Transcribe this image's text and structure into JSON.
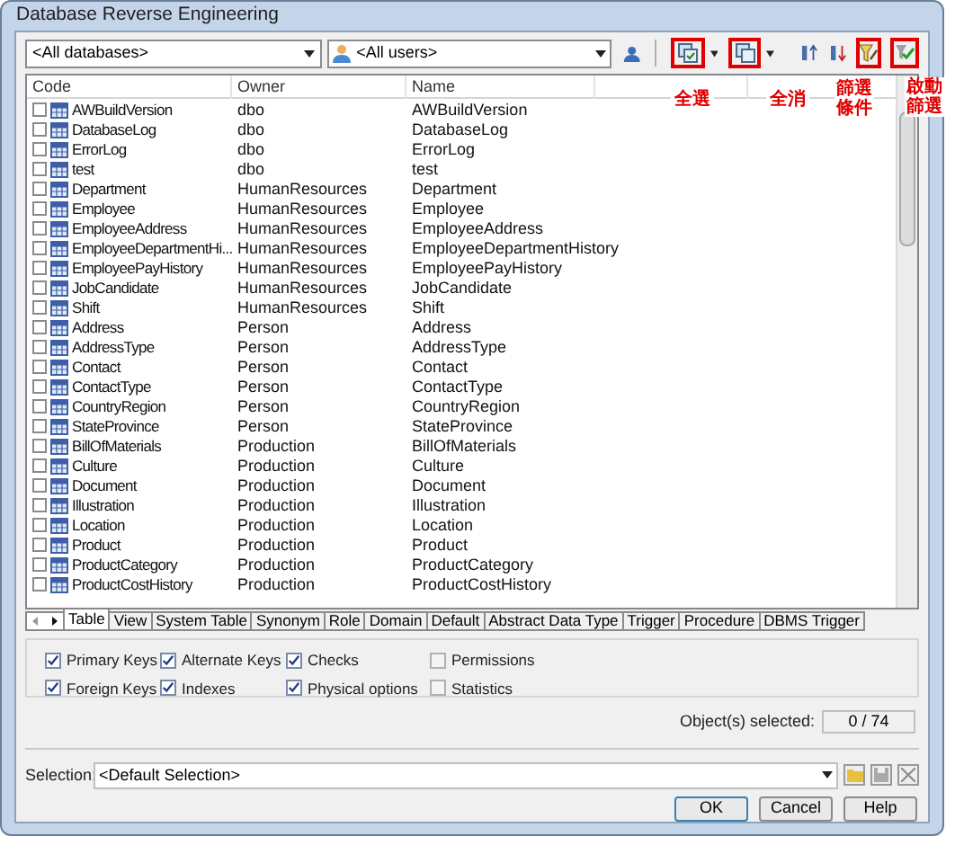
{
  "window": {
    "title": "Database Reverse Engineering"
  },
  "toolbar": {
    "database_combo": "<All databases>",
    "user_combo": "<All users>"
  },
  "annotations": [
    {
      "text": "全選"
    },
    {
      "text": "全消"
    },
    {
      "text": "篩選條件"
    },
    {
      "text": "啟動篩選"
    }
  ],
  "table": {
    "columns": [
      "Code",
      "Owner",
      "Name"
    ],
    "rows": [
      {
        "code": "AWBuildVersion",
        "owner": "dbo",
        "name": "AWBuildVersion",
        "checked": false
      },
      {
        "code": "DatabaseLog",
        "owner": "dbo",
        "name": "DatabaseLog",
        "checked": false
      },
      {
        "code": "ErrorLog",
        "owner": "dbo",
        "name": "ErrorLog",
        "checked": false
      },
      {
        "code": "test",
        "owner": "dbo",
        "name": "test",
        "checked": false
      },
      {
        "code": "Department",
        "owner": "HumanResources",
        "name": "Department",
        "checked": false
      },
      {
        "code": "Employee",
        "owner": "HumanResources",
        "name": "Employee",
        "checked": false
      },
      {
        "code": "EmployeeAddress",
        "owner": "HumanResources",
        "name": "EmployeeAddress",
        "checked": false
      },
      {
        "code": "EmployeeDepartmentHi...",
        "owner": "HumanResources",
        "name": "EmployeeDepartmentHistory",
        "checked": false
      },
      {
        "code": "EmployeePayHistory",
        "owner": "HumanResources",
        "name": "EmployeePayHistory",
        "checked": false
      },
      {
        "code": "JobCandidate",
        "owner": "HumanResources",
        "name": "JobCandidate",
        "checked": false
      },
      {
        "code": "Shift",
        "owner": "HumanResources",
        "name": "Shift",
        "checked": false
      },
      {
        "code": "Address",
        "owner": "Person",
        "name": "Address",
        "checked": false
      },
      {
        "code": "AddressType",
        "owner": "Person",
        "name": "AddressType",
        "checked": false
      },
      {
        "code": "Contact",
        "owner": "Person",
        "name": "Contact",
        "checked": false
      },
      {
        "code": "ContactType",
        "owner": "Person",
        "name": "ContactType",
        "checked": false
      },
      {
        "code": "CountryRegion",
        "owner": "Person",
        "name": "CountryRegion",
        "checked": false
      },
      {
        "code": "StateProvince",
        "owner": "Person",
        "name": "StateProvince",
        "checked": false
      },
      {
        "code": "BillOfMaterials",
        "owner": "Production",
        "name": "BillOfMaterials",
        "checked": false
      },
      {
        "code": "Culture",
        "owner": "Production",
        "name": "Culture",
        "checked": false
      },
      {
        "code": "Document",
        "owner": "Production",
        "name": "Document",
        "checked": false
      },
      {
        "code": "Illustration",
        "owner": "Production",
        "name": "Illustration",
        "checked": false
      },
      {
        "code": "Location",
        "owner": "Production",
        "name": "Location",
        "checked": false
      },
      {
        "code": "Product",
        "owner": "Production",
        "name": "Product",
        "checked": false
      },
      {
        "code": "ProductCategory",
        "owner": "Production",
        "name": "ProductCategory",
        "checked": false
      },
      {
        "code": "ProductCostHistory",
        "owner": "Production",
        "name": "ProductCostHistory",
        "checked": false
      }
    ]
  },
  "tabs": [
    {
      "label": "Table",
      "selected": true
    },
    {
      "label": "View",
      "selected": false
    },
    {
      "label": "System Table",
      "selected": false
    },
    {
      "label": "Synonym",
      "selected": false
    },
    {
      "label": "Role",
      "selected": false
    },
    {
      "label": "Domain",
      "selected": false
    },
    {
      "label": "Default",
      "selected": false
    },
    {
      "label": "Abstract Data Type",
      "selected": false
    },
    {
      "label": "Trigger",
      "selected": false
    },
    {
      "label": "Procedure",
      "selected": false
    },
    {
      "label": "DBMS Trigger",
      "selected": false
    }
  ],
  "options": [
    {
      "label": "Primary Keys",
      "checked": true
    },
    {
      "label": "Alternate Keys",
      "checked": true
    },
    {
      "label": "Checks",
      "checked": true
    },
    {
      "label": "Permissions",
      "checked": false
    },
    {
      "label": "Foreign Keys",
      "checked": true
    },
    {
      "label": "Indexes",
      "checked": true
    },
    {
      "label": "Physical options",
      "checked": true
    },
    {
      "label": "Statistics",
      "checked": false
    }
  ],
  "objects_selected": {
    "label": "Object(s) selected:",
    "value": "0 / 74"
  },
  "selection": {
    "label": "Selection:",
    "value": "<Default Selection>"
  },
  "buttons": [
    "OK",
    "Cancel",
    "Help"
  ]
}
